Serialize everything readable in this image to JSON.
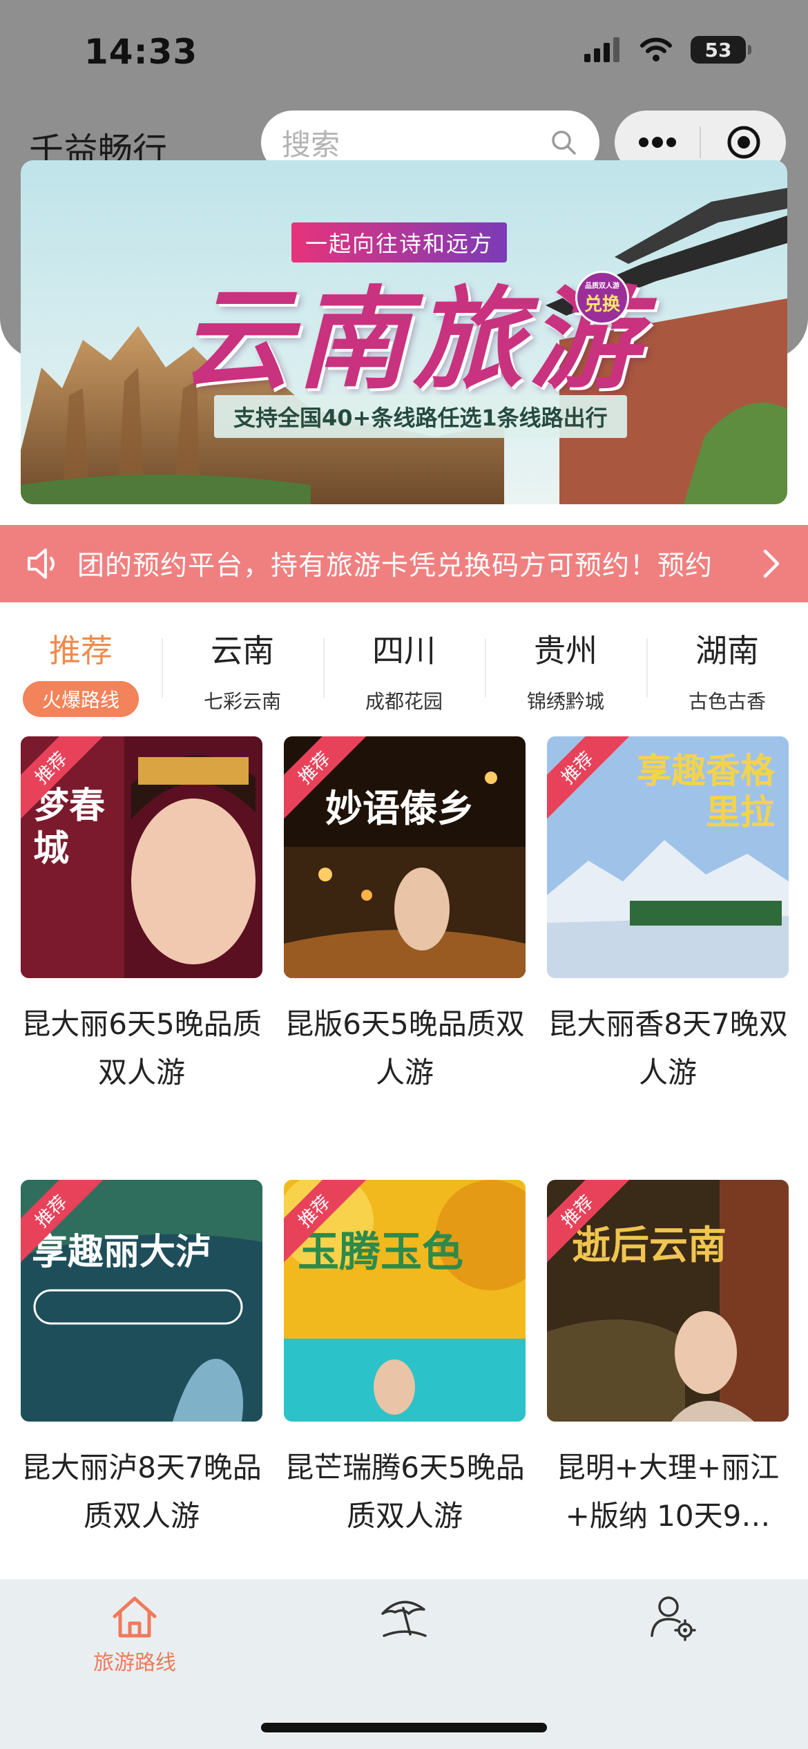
{
  "status": {
    "time": "14:33",
    "battery": "53"
  },
  "header": {
    "title": "千益畅行",
    "search_placeholder": "搜索"
  },
  "banner": {
    "tagline": "一起向往诗和远方",
    "title": "云南旅游",
    "badge": "兑换",
    "badge_small": "品质双人游",
    "subtitle": "支持全国40+条线路任选1条线路出行"
  },
  "notice": {
    "text": "团的预约平台，持有旅游卡凭兑换码方可预约！预约"
  },
  "regions": [
    {
      "name": "推荐",
      "desc": "火爆路线",
      "active": true
    },
    {
      "name": "云南",
      "desc": "七彩云南",
      "active": false
    },
    {
      "name": "四川",
      "desc": "成都花园",
      "active": false
    },
    {
      "name": "贵州",
      "desc": "锦绣黔城",
      "active": false
    },
    {
      "name": "湖南",
      "desc": "古色古香",
      "active": false
    }
  ],
  "routes": [
    {
      "badge": "推荐",
      "title": "昆大丽6天5晚品质双人游",
      "image_text": "梦春城"
    },
    {
      "badge": "推荐",
      "title": "昆版6天5晚品质双人游",
      "image_text": "妙语傣乡"
    },
    {
      "badge": "推荐",
      "title": "昆大丽香8天7晚双人游",
      "image_text": "享趣香格里拉"
    },
    {
      "badge": "推荐",
      "title": "昆大丽泸8天7晚品质双人游",
      "image_text": "享趣丽大泸"
    },
    {
      "badge": "推荐",
      "title": "昆芒瑞腾6天5晚品质双人游",
      "image_text": "玉腾玉色"
    },
    {
      "badge": "推荐",
      "title": "昆明+大理+丽江+版纳 10天9…",
      "image_text": "逝后云南"
    }
  ],
  "tabbar": {
    "items": [
      {
        "label": "旅游路线",
        "icon": "home-icon",
        "active": true
      },
      {
        "label": "",
        "icon": "beach-umbrella-icon",
        "active": false
      },
      {
        "label": "",
        "icon": "user-settings-icon",
        "active": false
      }
    ],
    "active_color": "#f07a5b"
  },
  "colors": {
    "accent": "#f08a4b",
    "notice_bg": "#f08080",
    "ribbon": "#e8425a"
  }
}
